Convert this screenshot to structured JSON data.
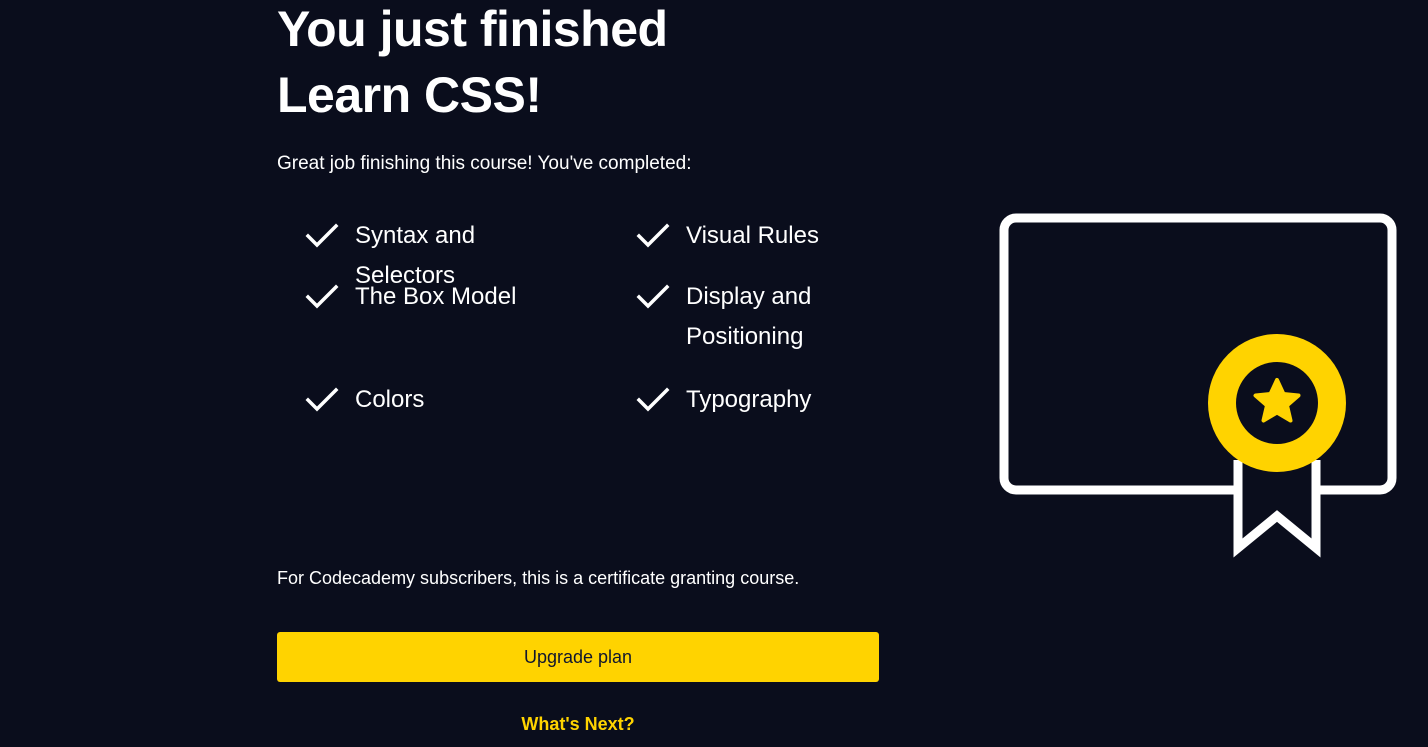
{
  "hero": {
    "title_line1": "You just finished",
    "title_line2": "Learn CSS!",
    "subtitle": "Great job finishing this course! You've completed:"
  },
  "completed_topics": [
    "Syntax and Selectors",
    "Visual Rules",
    "The Box Model",
    "Display and Positioning",
    "Colors",
    "Typography"
  ],
  "certificate_note": "For Codecademy subscribers, this is a certificate granting course.",
  "actions": {
    "upgrade_label": "Upgrade plan",
    "whats_next_label": "What's Next?"
  },
  "icons": {
    "check": "check-icon",
    "certificate": "certificate-icon"
  },
  "colors": {
    "background": "#0a0d1c",
    "accent": "#ffd300",
    "text": "#ffffff"
  }
}
